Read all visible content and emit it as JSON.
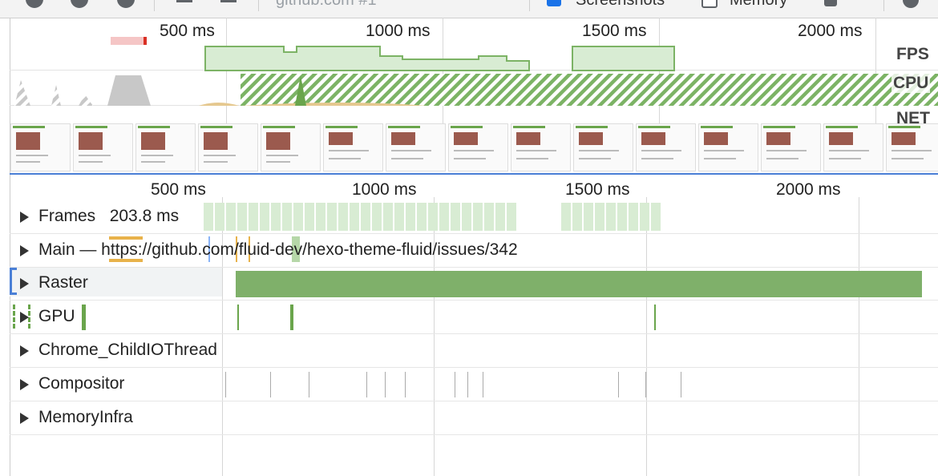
{
  "toolbar": {
    "url_text": "github.com #1",
    "screenshots_label": "Screenshots",
    "memory_label": "Memory"
  },
  "overview": {
    "ticks": [
      "500 ms",
      "1000 ms",
      "1500 ms",
      "2000 ms"
    ],
    "tracks": {
      "fps": "FPS",
      "cpu": "CPU",
      "net": "NET"
    }
  },
  "timeline": {
    "ticks": [
      "500 ms",
      "1000 ms",
      "1500 ms",
      "2000 ms"
    ],
    "tracks": [
      {
        "label": "Frames",
        "extra": "203.8 ms"
      },
      {
        "label": "Main — https://github.com/fluid-dev/hexo-theme-fluid/issues/342"
      },
      {
        "label": "Raster"
      },
      {
        "label": "GPU"
      },
      {
        "label": "Chrome_ChildIOThread"
      },
      {
        "label": "Compositor"
      },
      {
        "label": "MemoryInfra"
      }
    ]
  },
  "colors": {
    "frame": "#d8ecd3",
    "raster": "#7fb06a",
    "gpu": "#6aa54c",
    "cpu_hatch": "#7cb365",
    "selection": "#4a7fd6",
    "warning": "#e8b24a"
  }
}
